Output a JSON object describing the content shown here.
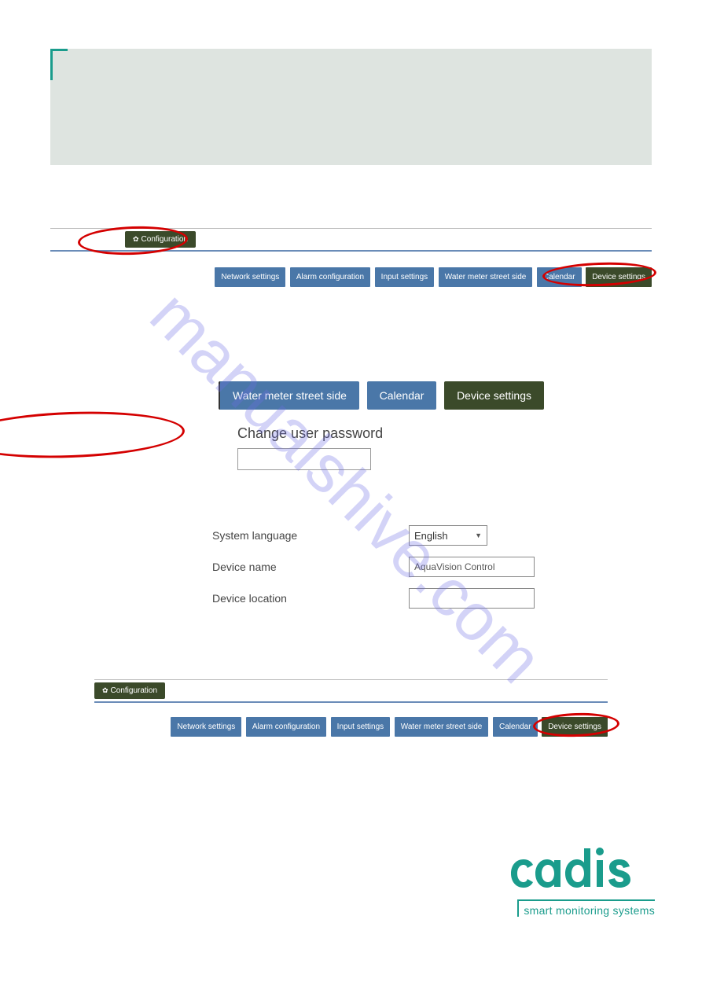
{
  "watermark": "manualshive.com",
  "nav1": {
    "config_label": "Configuration",
    "tabs": [
      {
        "label": "Network settings"
      },
      {
        "label": "Alarm configuration"
      },
      {
        "label": "Input settings"
      },
      {
        "label": "Water meter street side"
      },
      {
        "label": "Calendar"
      },
      {
        "label": "Device settings"
      }
    ]
  },
  "zoom": {
    "tabs": [
      {
        "label": "Water meter street side"
      },
      {
        "label": "Calendar"
      },
      {
        "label": "Device settings"
      }
    ],
    "sub_heading": "Change user password",
    "form": {
      "language_label": "System language",
      "language_value": "English",
      "device_name_label": "Device name",
      "device_name_value": "AquaVision Control",
      "device_location_label": "Device location",
      "device_location_value": ""
    }
  },
  "nav3": {
    "config_label": "Configuration",
    "tabs": [
      {
        "label": "Network settings"
      },
      {
        "label": "Alarm configuration"
      },
      {
        "label": "Input settings"
      },
      {
        "label": "Water meter street side"
      },
      {
        "label": "Calendar"
      },
      {
        "label": "Device settings"
      }
    ]
  },
  "logo": {
    "name": "cadis",
    "tagline": "smart monitoring systems"
  }
}
